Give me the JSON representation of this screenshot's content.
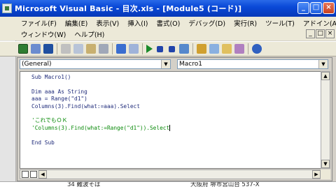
{
  "window": {
    "title": "Microsoft Visual Basic - 目次.xls - [Module5 (コード)]",
    "controls": [
      "_",
      "□",
      "×"
    ]
  },
  "menu": {
    "row1": [
      "ファイル(F)",
      "編集(E)",
      "表示(V)",
      "挿入(I)",
      "書式(O)",
      "デバッグ(D)",
      "実行(R)",
      "ツール(T)",
      "アドイン(A)"
    ],
    "row2": [
      "ウィンドウ(W)",
      "ヘルプ(H)"
    ]
  },
  "code_window": {
    "object_dropdown": "(General)",
    "proc_dropdown": "Macro1",
    "lines": [
      {
        "text": "Sub Macro1()",
        "comment": false
      },
      {
        "text": "",
        "comment": false
      },
      {
        "text": "Dim aaa As String",
        "comment": false
      },
      {
        "text": "aaa = Range(\"d1\")",
        "comment": false
      },
      {
        "text": "Columns(3).Find(what:=aaa).Select",
        "comment": false
      },
      {
        "text": "",
        "comment": false
      },
      {
        "text": "'これでもＯＫ",
        "comment": true
      },
      {
        "text": "'Columns(3).Find(what:=Range(\"d1\")).Select",
        "comment": true
      },
      {
        "text": "",
        "comment": false
      },
      {
        "text": "End Sub",
        "comment": false
      }
    ]
  },
  "bottom_strip": {
    "left": "34 難波そば",
    "right": "大阪府 堺市宮山台 537-X"
  },
  "colors": {
    "titlebar": "#0a49d8",
    "code_text": "#1f2b7a",
    "comment": "#0a8a0a"
  }
}
